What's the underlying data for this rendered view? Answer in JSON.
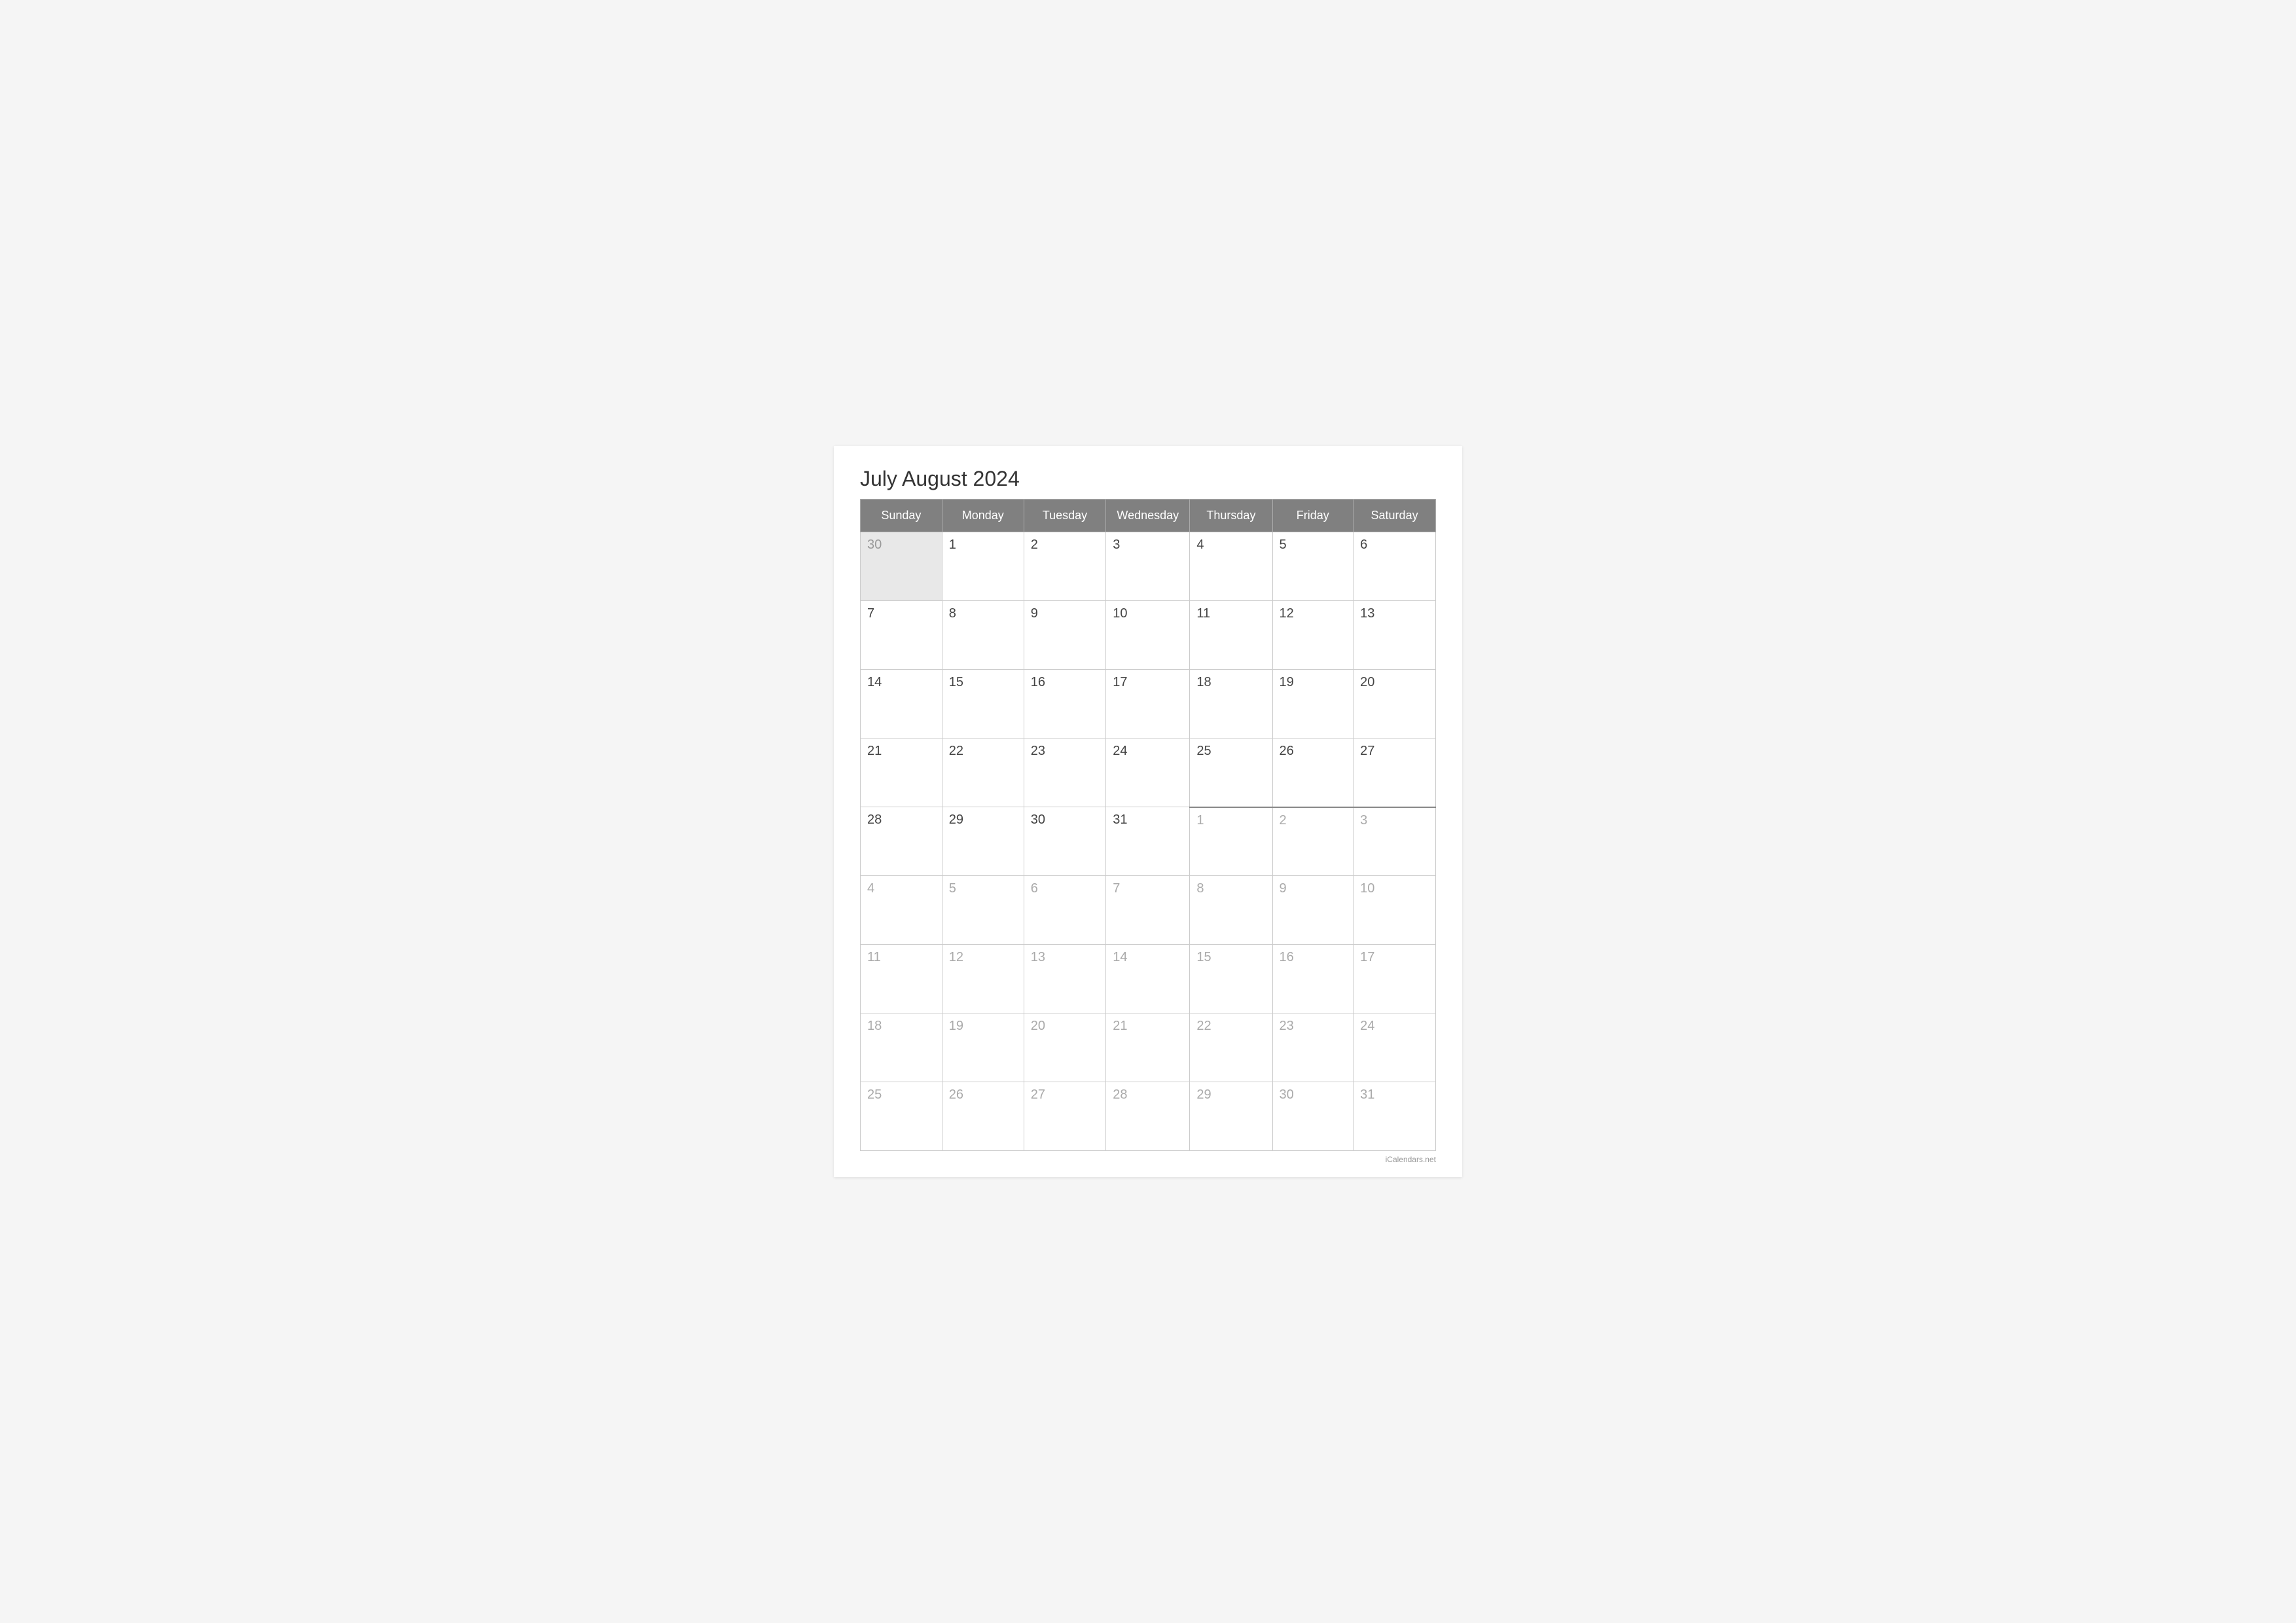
{
  "title": "July August 2024",
  "watermark": "iCalendars.net",
  "headers": [
    "Sunday",
    "Monday",
    "Tuesday",
    "Wednesday",
    "Thursday",
    "Friday",
    "Saturday"
  ],
  "rows": [
    [
      {
        "day": "30",
        "type": "prev-month"
      },
      {
        "day": "1",
        "type": "current"
      },
      {
        "day": "2",
        "type": "current"
      },
      {
        "day": "3",
        "type": "current"
      },
      {
        "day": "4",
        "type": "current"
      },
      {
        "day": "5",
        "type": "current"
      },
      {
        "day": "6",
        "type": "current"
      }
    ],
    [
      {
        "day": "7",
        "type": "current"
      },
      {
        "day": "8",
        "type": "current"
      },
      {
        "day": "9",
        "type": "current"
      },
      {
        "day": "10",
        "type": "current"
      },
      {
        "day": "11",
        "type": "current"
      },
      {
        "day": "12",
        "type": "current"
      },
      {
        "day": "13",
        "type": "current"
      }
    ],
    [
      {
        "day": "14",
        "type": "current"
      },
      {
        "day": "15",
        "type": "current"
      },
      {
        "day": "16",
        "type": "current"
      },
      {
        "day": "17",
        "type": "current"
      },
      {
        "day": "18",
        "type": "current"
      },
      {
        "day": "19",
        "type": "current"
      },
      {
        "day": "20",
        "type": "current"
      }
    ],
    [
      {
        "day": "21",
        "type": "current"
      },
      {
        "day": "22",
        "type": "current"
      },
      {
        "day": "23",
        "type": "current"
      },
      {
        "day": "24",
        "type": "current"
      },
      {
        "day": "25",
        "type": "current"
      },
      {
        "day": "26",
        "type": "current"
      },
      {
        "day": "27",
        "type": "current"
      }
    ],
    [
      {
        "day": "28",
        "type": "current"
      },
      {
        "day": "29",
        "type": "current"
      },
      {
        "day": "30",
        "type": "current"
      },
      {
        "day": "31",
        "type": "current"
      },
      {
        "day": "1",
        "type": "next-month",
        "divider": true
      },
      {
        "day": "2",
        "type": "next-month"
      },
      {
        "day": "3",
        "type": "next-month"
      }
    ],
    [
      {
        "day": "4",
        "type": "next-month"
      },
      {
        "day": "5",
        "type": "next-month"
      },
      {
        "day": "6",
        "type": "next-month"
      },
      {
        "day": "7",
        "type": "next-month"
      },
      {
        "day": "8",
        "type": "next-month"
      },
      {
        "day": "9",
        "type": "next-month"
      },
      {
        "day": "10",
        "type": "next-month"
      }
    ],
    [
      {
        "day": "11",
        "type": "next-month"
      },
      {
        "day": "12",
        "type": "next-month"
      },
      {
        "day": "13",
        "type": "next-month"
      },
      {
        "day": "14",
        "type": "next-month"
      },
      {
        "day": "15",
        "type": "next-month"
      },
      {
        "day": "16",
        "type": "next-month"
      },
      {
        "day": "17",
        "type": "next-month"
      }
    ],
    [
      {
        "day": "18",
        "type": "next-month"
      },
      {
        "day": "19",
        "type": "next-month"
      },
      {
        "day": "20",
        "type": "next-month"
      },
      {
        "day": "21",
        "type": "next-month"
      },
      {
        "day": "22",
        "type": "next-month"
      },
      {
        "day": "23",
        "type": "next-month"
      },
      {
        "day": "24",
        "type": "next-month"
      }
    ],
    [
      {
        "day": "25",
        "type": "next-month"
      },
      {
        "day": "26",
        "type": "next-month"
      },
      {
        "day": "27",
        "type": "next-month"
      },
      {
        "day": "28",
        "type": "next-month"
      },
      {
        "day": "29",
        "type": "next-month"
      },
      {
        "day": "30",
        "type": "next-month"
      },
      {
        "day": "31",
        "type": "next-month"
      }
    ]
  ]
}
